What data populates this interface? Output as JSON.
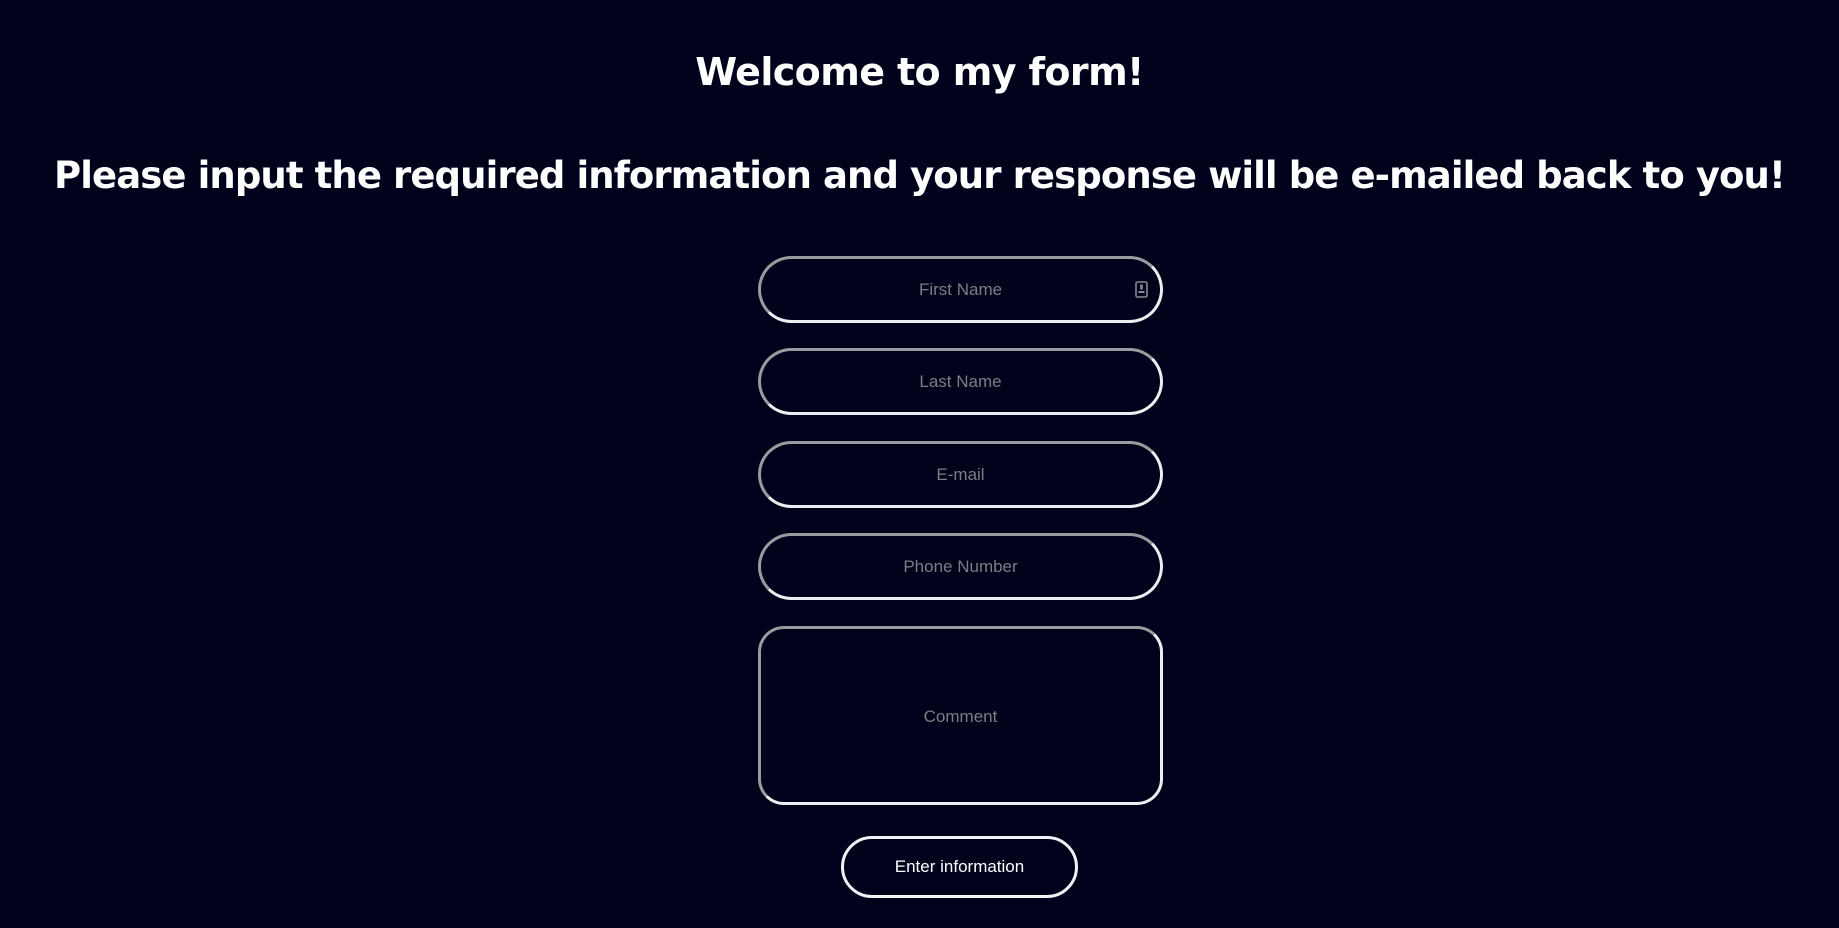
{
  "header": {
    "title": "Welcome to my form!",
    "subtitle": "Please input the required information and your response will be e-mailed back to you!"
  },
  "form": {
    "first_name": {
      "placeholder": "First Name",
      "value": "",
      "icon": "contact-card-icon"
    },
    "last_name": {
      "placeholder": "Last Name",
      "value": ""
    },
    "email": {
      "placeholder": "E-mail",
      "value": ""
    },
    "phone": {
      "placeholder": "Phone Number",
      "value": ""
    },
    "comment": {
      "placeholder": "Comment",
      "value": ""
    },
    "submit_label": "Enter information"
  },
  "colors": {
    "background": "#00021c",
    "text": "#ffffff",
    "placeholder": "#7d7d84",
    "border_light": "#eeeef0",
    "border_dim": "#9a9a9f"
  }
}
